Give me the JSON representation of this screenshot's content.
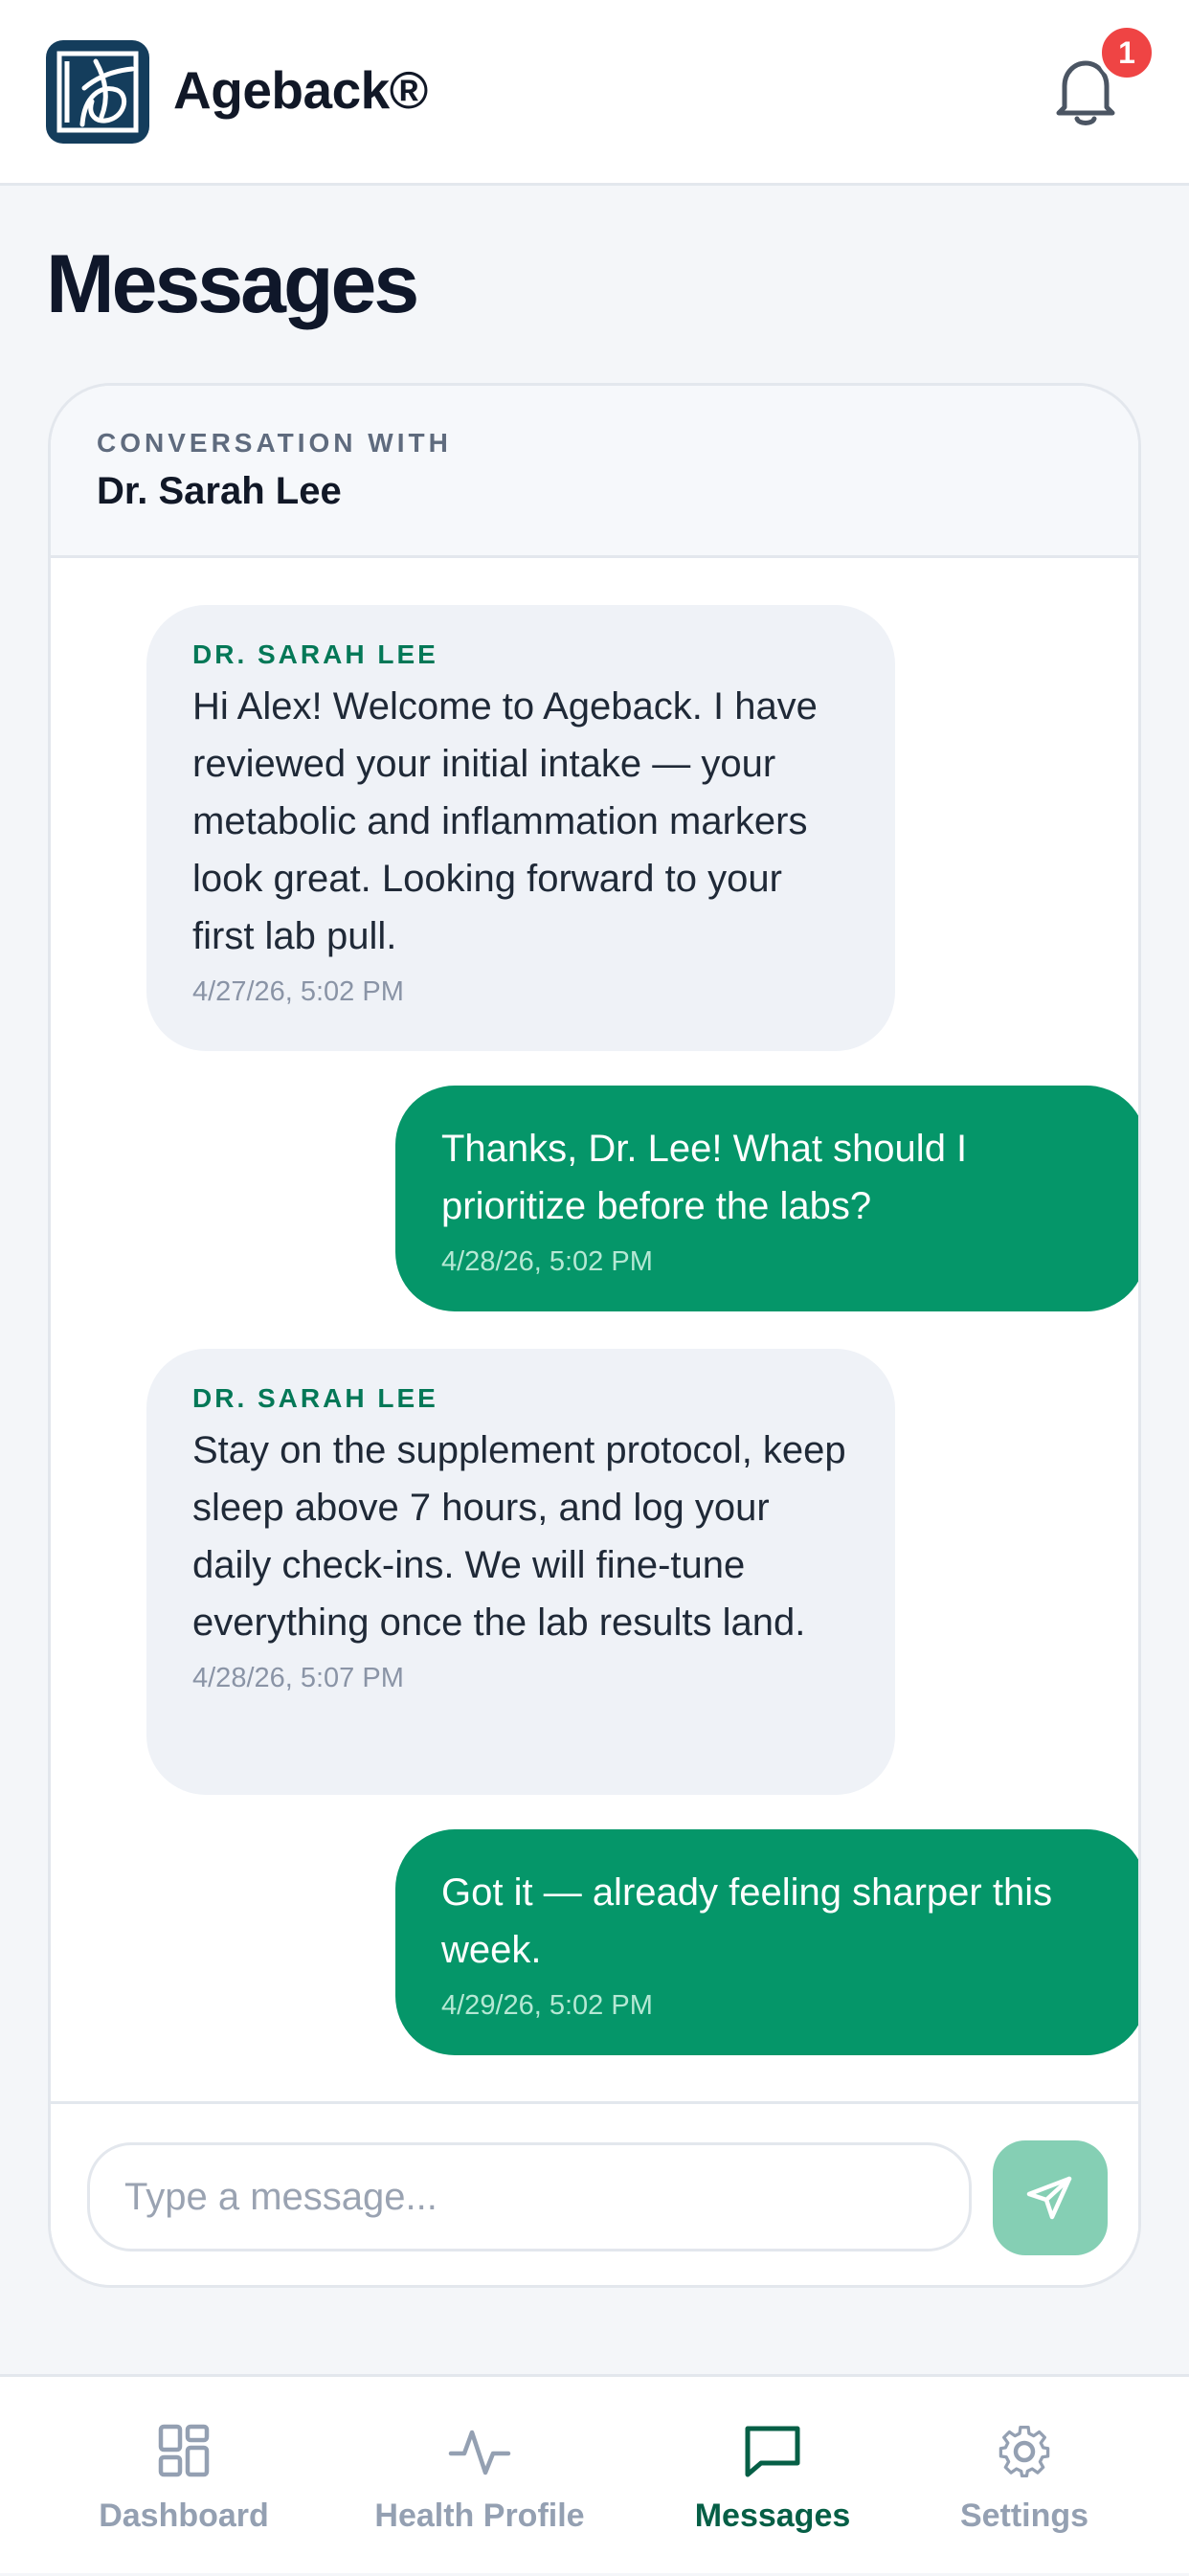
{
  "header": {
    "brand": "Ageback®",
    "notification_count": "1",
    "logo_icon": "ageback-logo-icon",
    "bell_icon": "bell-icon"
  },
  "page": {
    "title": "Messages"
  },
  "conversation": {
    "label": "CONVERSATION WITH",
    "name": "Dr. Sarah Lee",
    "messages": [
      {
        "direction": "incoming",
        "sender": "DR. SARAH LEE",
        "text": "Hi Alex! Welcome to Ageback. I have reviewed your initial intake — your metabolic and inflammation markers look great. Looking forward to your first lab pull.",
        "time": "4/27/26, 5:02 PM"
      },
      {
        "direction": "outgoing",
        "text": "Thanks, Dr. Lee! What should I prioritize before the labs?",
        "time": "4/28/26, 5:02 PM"
      },
      {
        "direction": "incoming",
        "sender": "DR. SARAH LEE",
        "text": "Stay on the supplement protocol, keep sleep above 7 hours, and log your daily check-ins. We will fine-tune everything once the lab results land.",
        "time": "4/28/26, 5:07 PM"
      },
      {
        "direction": "outgoing",
        "text": "Got it — already feeling sharper this week.",
        "time": "4/29/26, 5:02 PM"
      }
    ]
  },
  "composer": {
    "placeholder": "Type a message...",
    "value": "",
    "send_icon": "send-icon"
  },
  "tabs": [
    {
      "label": "Dashboard",
      "icon": "dashboard-icon",
      "active": false
    },
    {
      "label": "Health Profile",
      "icon": "activity-icon",
      "active": false
    },
    {
      "label": "Messages",
      "icon": "chat-icon",
      "active": true
    },
    {
      "label": "Settings",
      "icon": "gear-icon",
      "active": false
    }
  ],
  "colors": {
    "accent": "#059669",
    "accent_dark": "#065f46",
    "badge": "#ef4444",
    "logo_bg": "#143d5c",
    "send_button": "#85cfb4"
  }
}
